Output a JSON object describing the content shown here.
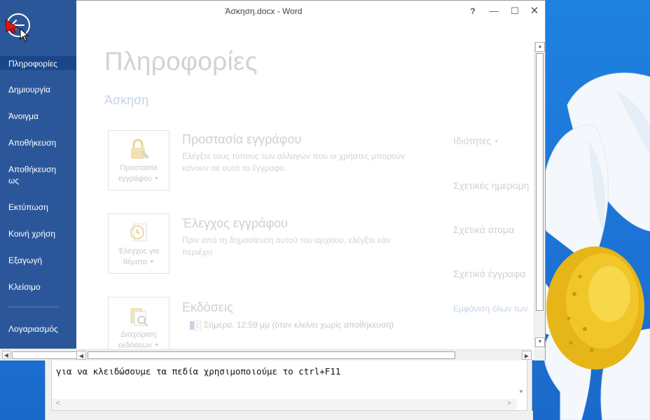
{
  "window": {
    "title": "Άσκηση.docx - Word",
    "help": "?",
    "minimize": "—",
    "maximize": "☐",
    "close": "✕"
  },
  "nav": {
    "items": [
      {
        "label": "Πληροφορίες",
        "active": true
      },
      {
        "label": "Δημιουργία"
      },
      {
        "label": "Άνοιγμα"
      },
      {
        "label": "Αποθήκευση"
      },
      {
        "label": "Αποθήκευση ως"
      },
      {
        "label": "Εκτύπωση"
      },
      {
        "label": "Κοινή χρήση"
      },
      {
        "label": "Εξαγωγή"
      },
      {
        "label": "Κλείσιμο"
      }
    ],
    "account": "Λογαριασμός"
  },
  "info": {
    "title": "Πληροφορίες",
    "doc_name": "Άσκηση",
    "protect": {
      "tile_label_1": "Προστασία",
      "tile_label_2": "εγγράφου",
      "heading": "Προστασία εγγράφου",
      "desc": "Ελέγξτε τους τύπους των αλλαγών που οι χρήστες μπορούν κανουν σε αυτό το έγγραφο."
    },
    "inspect": {
      "tile_label_1": "Έλεγχος για",
      "tile_label_2": "θέματα",
      "heading": "Έλεγχος εγγράφου",
      "desc": "Πριν από τη δημοσίευση αυτού του αρχείου, ελέγξτε εάν περιέχει"
    },
    "versions": {
      "tile_label_1": "Διαχείριση",
      "tile_label_2": "εκδόσεων",
      "heading": "Εκδόσεις",
      "entry": "Σήμερα, 12:59 μμ (όταν κλείνει χωρίς αποθήκευση)"
    },
    "properties": {
      "heading": "Ιδιότητες",
      "related_dates": "Σχετικές ημερομη",
      "related_people": "Σχετικά άτομα",
      "related_docs": "Σχετικά έγγραφα",
      "show_all": "Εμφάνιση όλων των"
    }
  },
  "note": {
    "text": "για να κλειδώσουμε τα πεδία χρησιμοποιούμε το ctrl+F11"
  },
  "colors": {
    "nav_bg": "#2b579a",
    "nav_active": "#19478a",
    "desktop_blue": "#1d74d6"
  }
}
